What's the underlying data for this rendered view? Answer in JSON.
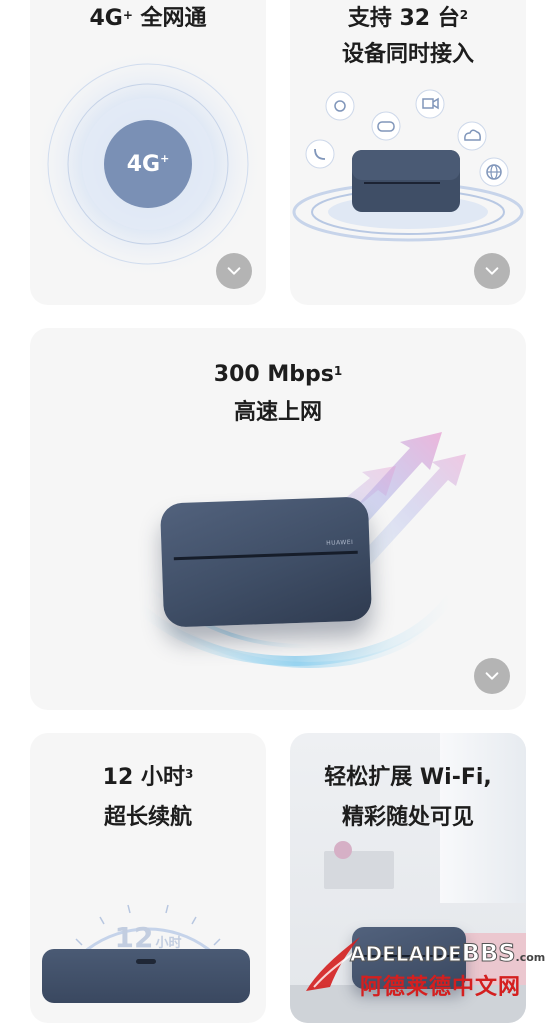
{
  "cards": {
    "network": {
      "title_main": "4G",
      "title_sup": "+",
      "title_rest": " 全网通",
      "badge_text": "4G",
      "badge_sup": "+"
    },
    "devices": {
      "line1_main": "支持 32 台",
      "line1_sup": "2",
      "line2": "设备同时接入"
    },
    "speed": {
      "line1_main": "300 Mbps",
      "line1_sup": "1",
      "line2": "高速上网",
      "device_brand": "HUAWEI"
    },
    "battery": {
      "line1_main": "12 小时",
      "line1_sup": "3",
      "line2": "超长续航",
      "dial_number": "12",
      "dial_unit": "小时"
    },
    "wifi": {
      "line1": "轻松扩展 Wi-Fi,",
      "line2": "精彩随处可见"
    }
  },
  "watermark": {
    "brand_prefix": "ADELAIDE",
    "brand_suffix": "BBS",
    "domain": ".com",
    "cn_text": "阿德莱德中文网"
  },
  "icons": [
    "eye-icon",
    "video-camera-icon",
    "phone-icon",
    "gamepad-icon",
    "cloud-icon",
    "globe-icon",
    "chevron-down-icon"
  ],
  "colors": {
    "card_bg": "#f6f6f6",
    "device_blue": "#3f4e66",
    "badge_blue": "#7a90b5",
    "button_gray": "#b4b4b4",
    "watermark_red": "#d41f1f"
  }
}
